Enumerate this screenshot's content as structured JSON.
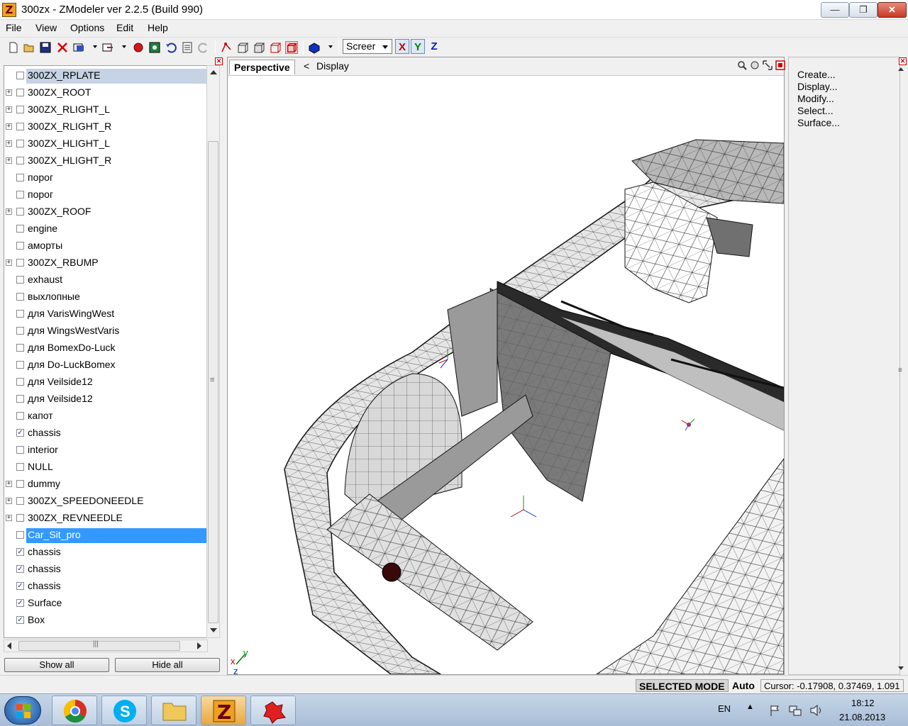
{
  "window": {
    "title": "300zx - ZModeler ver 2.2.5 (Build 990)",
    "app_icon": "Z",
    "minimize": "—",
    "maximize": "❐",
    "close": "✕"
  },
  "menu": [
    "File",
    "View",
    "Options",
    "Edit",
    "Help"
  ],
  "toolbar": {
    "view_select": "Screer",
    "axis_x": "X",
    "axis_y": "Y",
    "axis_z": "Z"
  },
  "tree": {
    "items": [
      {
        "label": "300ZX_RPLATE",
        "expandable": false,
        "checked": false,
        "selected": "gray"
      },
      {
        "label": "300ZX_ROOT",
        "expandable": true,
        "checked": false,
        "selected": ""
      },
      {
        "label": "300ZX_RLIGHT_L",
        "expandable": true,
        "checked": false,
        "selected": ""
      },
      {
        "label": "300ZX_RLIGHT_R",
        "expandable": true,
        "checked": false,
        "selected": ""
      },
      {
        "label": "300ZX_HLIGHT_L",
        "expandable": true,
        "checked": false,
        "selected": ""
      },
      {
        "label": "300ZX_HLIGHT_R",
        "expandable": true,
        "checked": false,
        "selected": ""
      },
      {
        "label": "порог",
        "expandable": false,
        "checked": false,
        "selected": ""
      },
      {
        "label": "порог",
        "expandable": false,
        "checked": false,
        "selected": ""
      },
      {
        "label": "300ZX_ROOF",
        "expandable": true,
        "checked": false,
        "selected": ""
      },
      {
        "label": "engine",
        "expandable": false,
        "checked": false,
        "selected": ""
      },
      {
        "label": "аморты",
        "expandable": false,
        "checked": false,
        "selected": ""
      },
      {
        "label": "300ZX_RBUMP",
        "expandable": true,
        "checked": false,
        "selected": ""
      },
      {
        "label": "exhaust",
        "expandable": false,
        "checked": false,
        "selected": ""
      },
      {
        "label": "выхлопные",
        "expandable": false,
        "checked": false,
        "selected": ""
      },
      {
        "label": "для VarisWingWest",
        "expandable": false,
        "checked": false,
        "selected": ""
      },
      {
        "label": "для WingsWestVaris",
        "expandable": false,
        "checked": false,
        "selected": ""
      },
      {
        "label": "для BomexDo-Luck",
        "expandable": false,
        "checked": false,
        "selected": ""
      },
      {
        "label": "для Do-LuckBomex",
        "expandable": false,
        "checked": false,
        "selected": ""
      },
      {
        "label": "для Veilside12",
        "expandable": false,
        "checked": false,
        "selected": ""
      },
      {
        "label": "для Veilside12",
        "expandable": false,
        "checked": false,
        "selected": ""
      },
      {
        "label": "капот",
        "expandable": false,
        "checked": false,
        "selected": ""
      },
      {
        "label": "chassis",
        "expandable": false,
        "checked": true,
        "selected": ""
      },
      {
        "label": "interior",
        "expandable": false,
        "checked": false,
        "selected": ""
      },
      {
        "label": "NULL",
        "expandable": false,
        "checked": false,
        "selected": ""
      },
      {
        "label": "dummy",
        "expandable": true,
        "checked": false,
        "selected": ""
      },
      {
        "label": "300ZX_SPEEDONEEDLE",
        "expandable": true,
        "checked": false,
        "selected": ""
      },
      {
        "label": "300ZX_REVNEEDLE",
        "expandable": true,
        "checked": false,
        "selected": ""
      },
      {
        "label": "Car_Sit_pro",
        "expandable": false,
        "checked": false,
        "selected": "blue"
      },
      {
        "label": "chassis",
        "expandable": false,
        "checked": true,
        "selected": ""
      },
      {
        "label": "chassis",
        "expandable": false,
        "checked": true,
        "selected": ""
      },
      {
        "label": "chassis",
        "expandable": false,
        "checked": true,
        "selected": ""
      },
      {
        "label": "Surface",
        "expandable": false,
        "checked": true,
        "selected": ""
      },
      {
        "label": "Box",
        "expandable": false,
        "checked": true,
        "selected": ""
      }
    ],
    "hscroll_grip": "|||",
    "vscroll_grip": "≡"
  },
  "buttons": {
    "show_all": "Show all",
    "hide_all": "Hide all"
  },
  "viewport": {
    "tab": "Perspective",
    "back_arrow": "<",
    "display": "Display",
    "axis_label_x": "x",
    "axis_label_y": "y",
    "axis_label_z": "z"
  },
  "right_panel": {
    "items": [
      "Create...",
      "Display...",
      "Modify...",
      "Select...",
      "Surface..."
    ]
  },
  "status": {
    "mode": "SELECTED MODE",
    "auto": "Auto",
    "cursor": "Cursor: -0.17908, 0.37469, 1.091"
  },
  "taskbar": {
    "language": "EN",
    "time": "18:12",
    "date": "21.08.2013",
    "apps": [
      "chrome-icon",
      "skype-icon",
      "explorer-icon",
      "zmodeler-icon",
      "game-icon"
    ]
  },
  "colors": {
    "selection_blue": "#3399ff",
    "selection_gray": "#c5d3e4",
    "axis_x": "#c00000",
    "axis_y": "#008000",
    "axis_z": "#0020c0"
  }
}
